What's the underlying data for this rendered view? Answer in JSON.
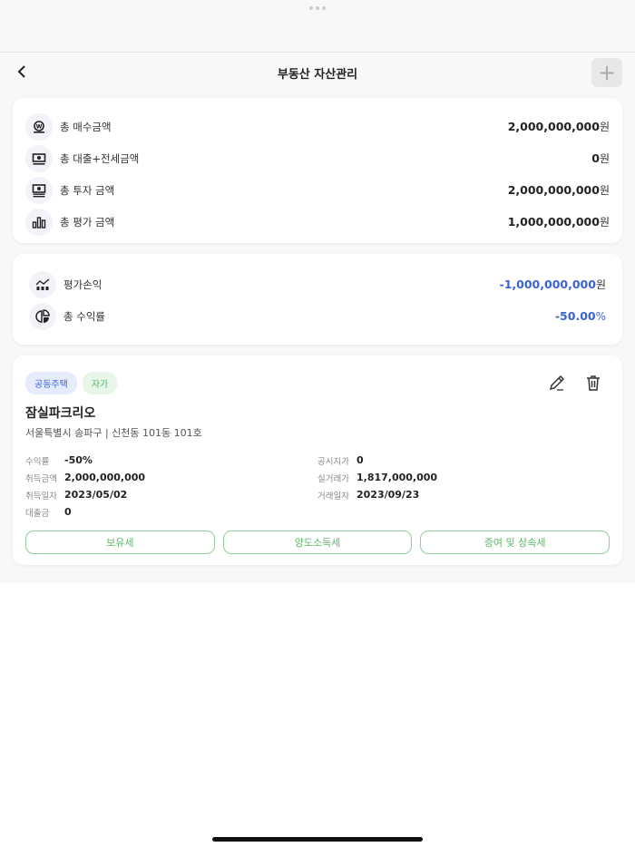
{
  "header": {
    "title": "부동산 자산관리"
  },
  "summary": [
    {
      "icon": "won-coin-icon",
      "label": "총 매수금액",
      "value": "2,000,000,000",
      "unit": "원"
    },
    {
      "icon": "cash-icon",
      "label": "총 대출+전세금액",
      "value": "0",
      "unit": "원"
    },
    {
      "icon": "money-stack-icon",
      "label": "총 투자 금액",
      "value": "2,000,000,000",
      "unit": "원"
    },
    {
      "icon": "bar-chart-icon",
      "label": "총 평가 금액",
      "value": "1,000,000,000",
      "unit": "원"
    }
  ],
  "profit": [
    {
      "icon": "trend-icon",
      "label": "평가손익",
      "value": "-1,000,000,000",
      "unit": "원"
    },
    {
      "icon": "pie-chart-icon",
      "label": "총 수익률",
      "value": "-50.00",
      "unit": "%"
    }
  ],
  "property": {
    "badges": [
      "공동주택",
      "자가"
    ],
    "name": "잠실파크리오",
    "address": "서울특별시 송파구 | 신천동 101동 101호",
    "fields_left": [
      {
        "k": "수익률",
        "v": "-50%"
      },
      {
        "k": "취득금액",
        "v": "2,000,000,000"
      },
      {
        "k": "취득일자",
        "v": "2023/05/02"
      },
      {
        "k": "대출금",
        "v": "0"
      }
    ],
    "fields_right": [
      {
        "k": "공시지가",
        "v": "0"
      },
      {
        "k": "실거래가",
        "v": "1,817,000,000"
      },
      {
        "k": "거래일자",
        "v": "2023/09/23"
      }
    ],
    "buttons": [
      "보유세",
      "양도소득세",
      "증여 및 상속세"
    ]
  }
}
